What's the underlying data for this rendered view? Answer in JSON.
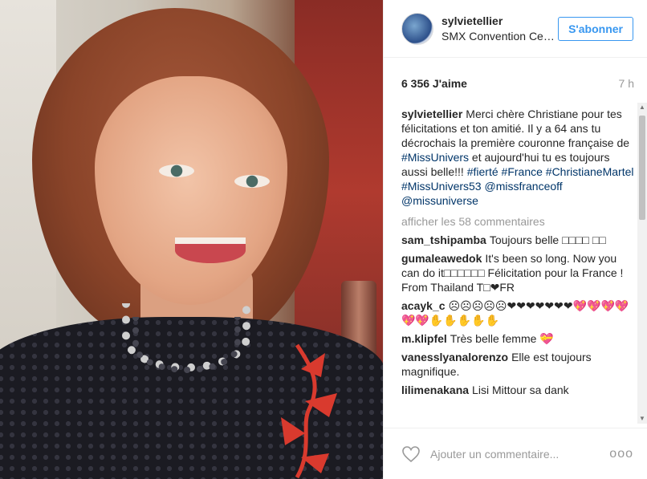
{
  "post": {
    "username": "sylvietellier",
    "location": "SMX Convention Center",
    "follow_label": "S'abonner",
    "likes": "6 356 J'aime",
    "time": "7 h"
  },
  "caption": {
    "user": "sylvietellier",
    "text_1": "Merci chère Christiane pour tes félicitations et ton amitié. Il y a 64 ans tu décrochais la première couronne française de ",
    "tag_1": "#MissUnivers",
    "text_2": " et aujourd'hui tu es toujours aussi belle!!! ",
    "tag_2": "#fierté",
    "tag_3": "#France",
    "tag_4": "#ChristianeMartel",
    "tag_5": "#MissUnivers53",
    "mention_1": "@missfranceoff",
    "mention_2": "@missuniverse"
  },
  "show_more": "afficher les 58 commentaires",
  "comments": [
    {
      "user": "sam_tshipamba",
      "text": "Toujours belle □□□□ □□"
    },
    {
      "user": "gumaleawedok",
      "text": "It's been so long. Now you can do it□□□□□□ Félicitation pour la France ! From Thailand T□❤FR"
    },
    {
      "user": "acayk_c",
      "text": "☹☹☹☹☹❤❤❤❤❤❤❤💖💖💖💖💖💖✋✋✋✋✋"
    },
    {
      "user": "m.klipfel",
      "text": "Très belle femme 💝"
    },
    {
      "user": "vanesslyanalorenzo",
      "text": "Elle est toujours magnifique."
    },
    {
      "user": "lilimenakana",
      "text": "Lisi Mittour sa dank"
    }
  ],
  "footer": {
    "placeholder": "Ajouter un commentaire...",
    "more": "ooo"
  },
  "colors": {
    "accent": "#3897f0",
    "link": "#003569",
    "muted": "#999999"
  },
  "icons": [
    "heart-icon",
    "more-options-icon",
    "scroll-up-icon",
    "scroll-down-icon"
  ]
}
